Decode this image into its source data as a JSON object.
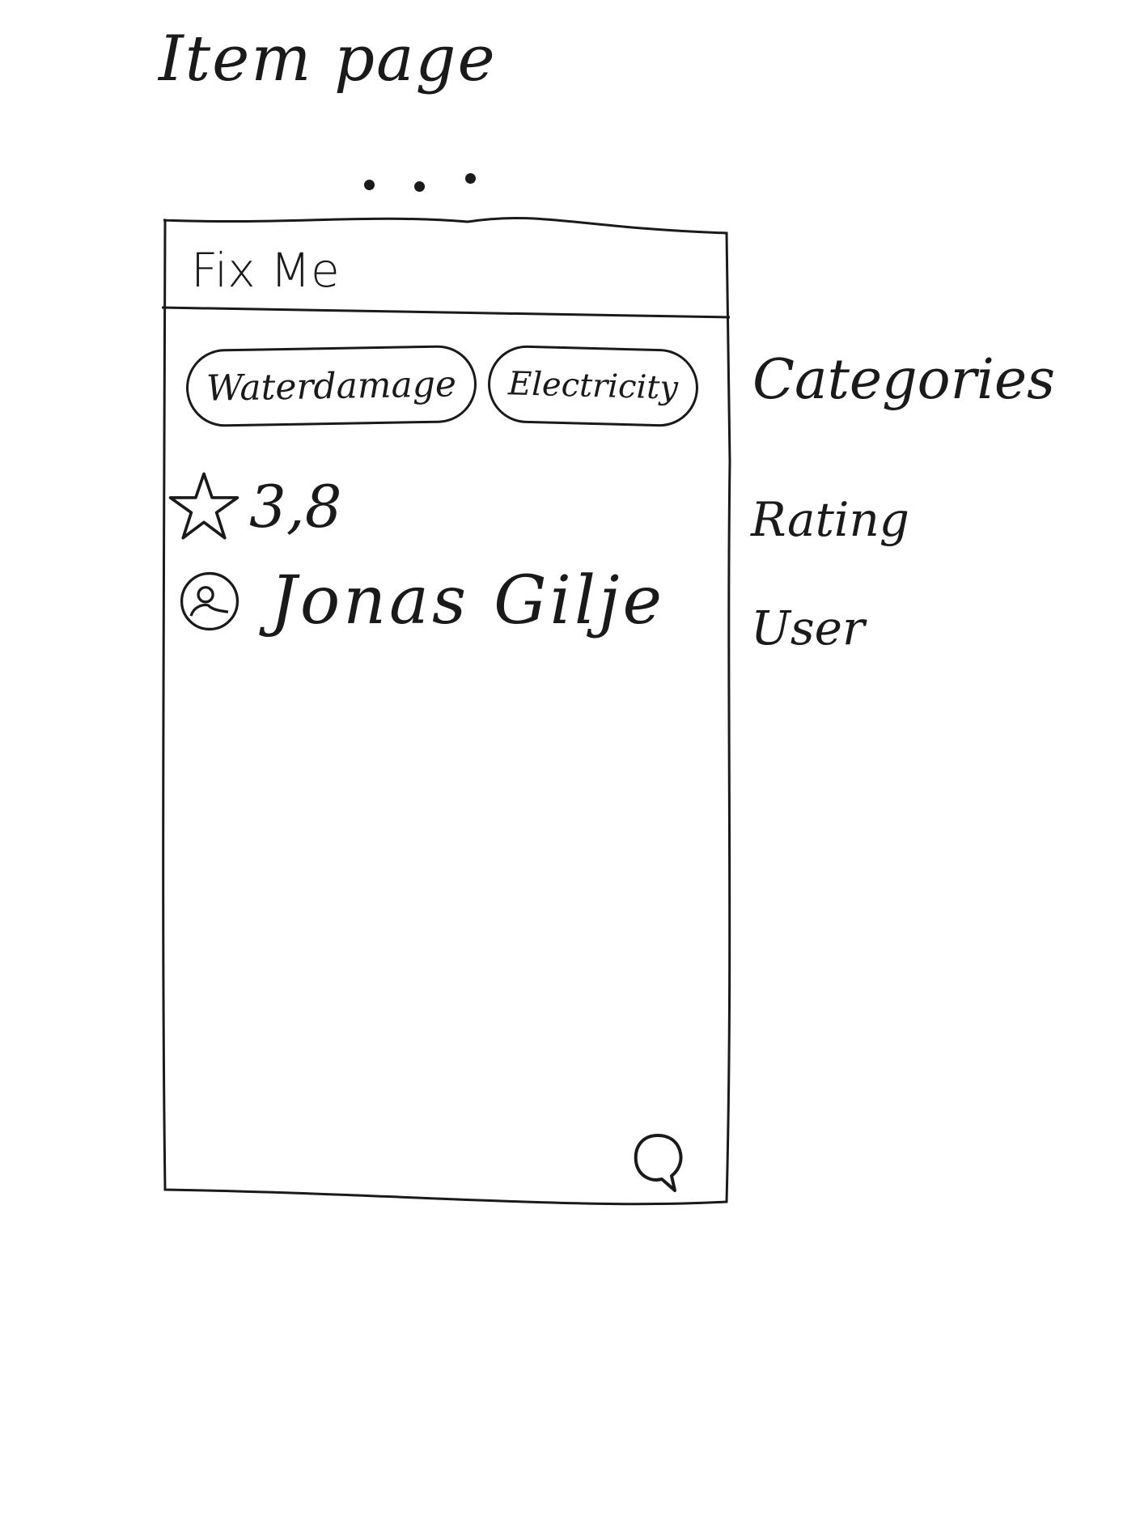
{
  "sheet": {
    "title": "Item page"
  },
  "app": {
    "title": "Fix Me",
    "categories": [
      {
        "label": "Waterdamage"
      },
      {
        "label": "Electricity"
      }
    ],
    "rating": {
      "value": "3,8",
      "icon": "star-icon"
    },
    "user": {
      "name": "Jonas Gilje",
      "icon": "avatar-icon"
    },
    "chat": {
      "icon": "chat-bubble-icon"
    }
  },
  "annotations": {
    "categories": "Categories",
    "rating": "Rating",
    "user": "User"
  }
}
